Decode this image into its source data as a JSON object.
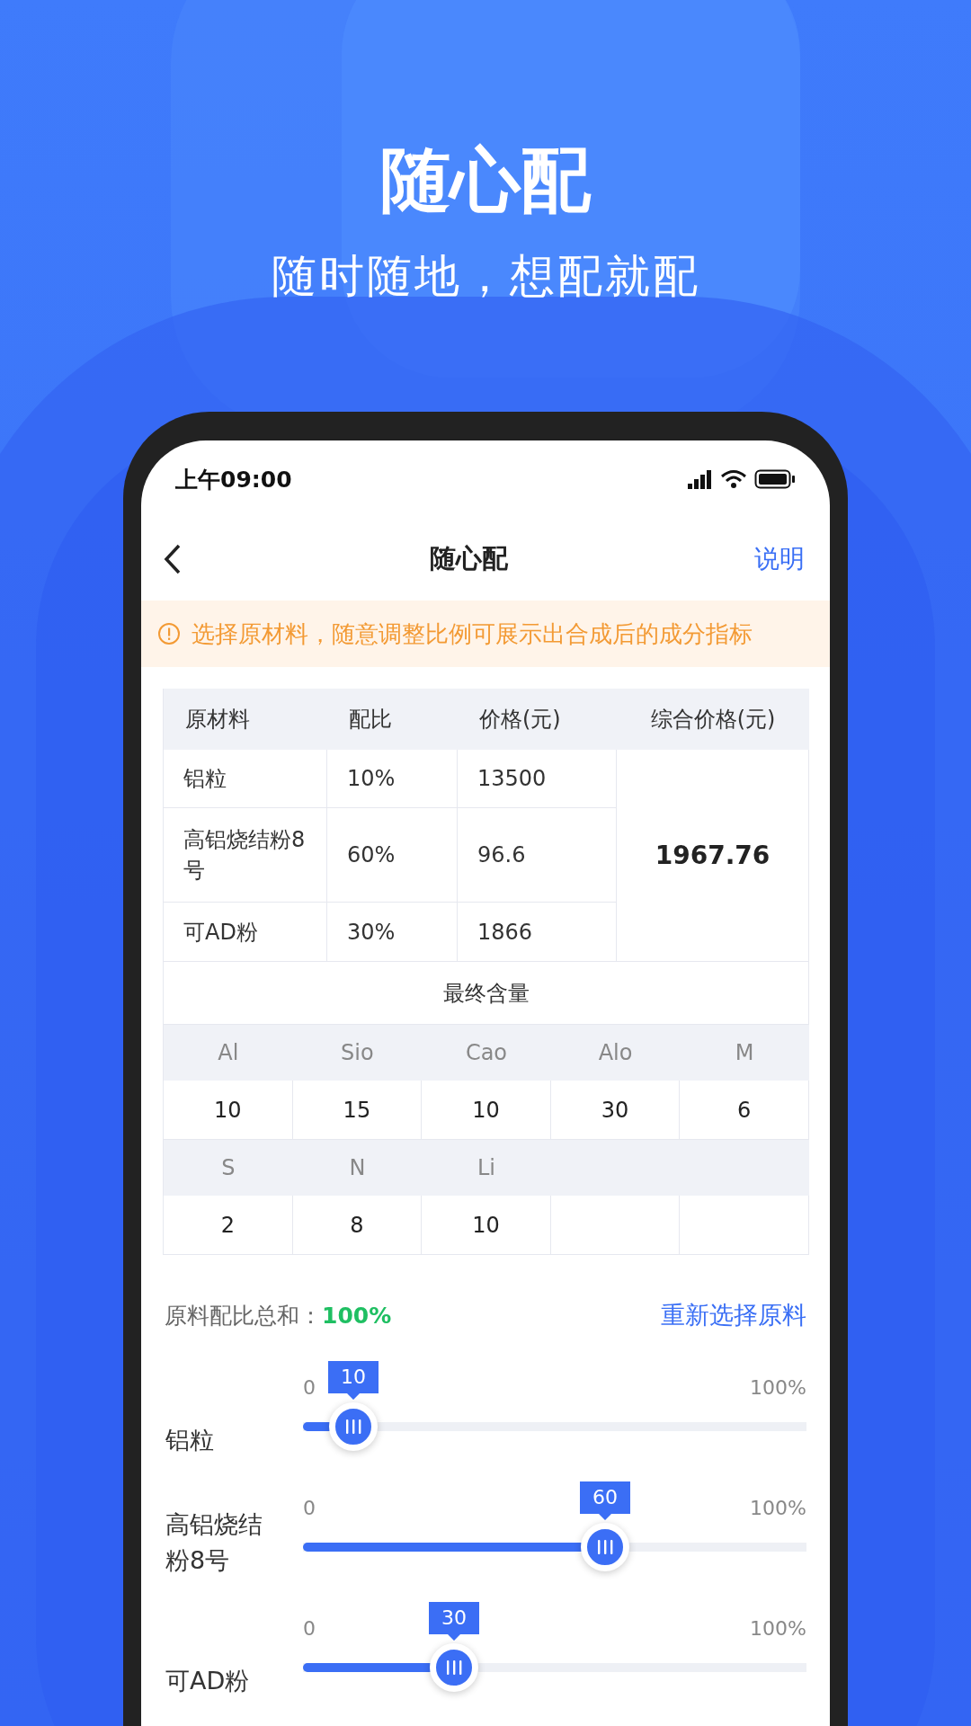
{
  "hero": {
    "title": "随心配",
    "subtitle": "随时随地，想配就配"
  },
  "status_bar": {
    "time": "上午09:00"
  },
  "nav": {
    "title": "随心配",
    "action": "说明"
  },
  "notice": {
    "text": "选择原材料，随意调整比例可展示出合成后的成分指标"
  },
  "price_table": {
    "columns": [
      "原材料",
      "配比",
      "价格(元)",
      "综合价格(元)"
    ],
    "rows": [
      {
        "material": "铝粒",
        "ratio": "10%",
        "price": "13500"
      },
      {
        "material": "高铝烧结粉8号",
        "ratio": "60%",
        "price": "96.6"
      },
      {
        "material": "可AD粉",
        "ratio": "30%",
        "price": "1866"
      }
    ],
    "total": "1967.76"
  },
  "content": {
    "title": "最终含量",
    "items": [
      {
        "name": "Al",
        "value": "10"
      },
      {
        "name": "Sio",
        "value": "15"
      },
      {
        "name": "Cao",
        "value": "10"
      },
      {
        "name": "Alo",
        "value": "30"
      },
      {
        "name": "M",
        "value": "6"
      },
      {
        "name": "S",
        "value": "2"
      },
      {
        "name": "N",
        "value": "8"
      },
      {
        "name": "Li",
        "value": "10"
      }
    ]
  },
  "summary": {
    "label": "原料配比总和：",
    "value": "100%",
    "action": "重新选择原料"
  },
  "sliders": [
    {
      "label": "铝粒",
      "min": "0",
      "max": "100%",
      "value": "10",
      "level": 0.1
    },
    {
      "label": "高铝烧结粉8号",
      "min": "0",
      "max": "100%",
      "value": "60",
      "level": 0.6
    },
    {
      "label": "可AD粉",
      "min": "0",
      "max": "100%",
      "value": "30",
      "level": 0.3
    }
  ]
}
